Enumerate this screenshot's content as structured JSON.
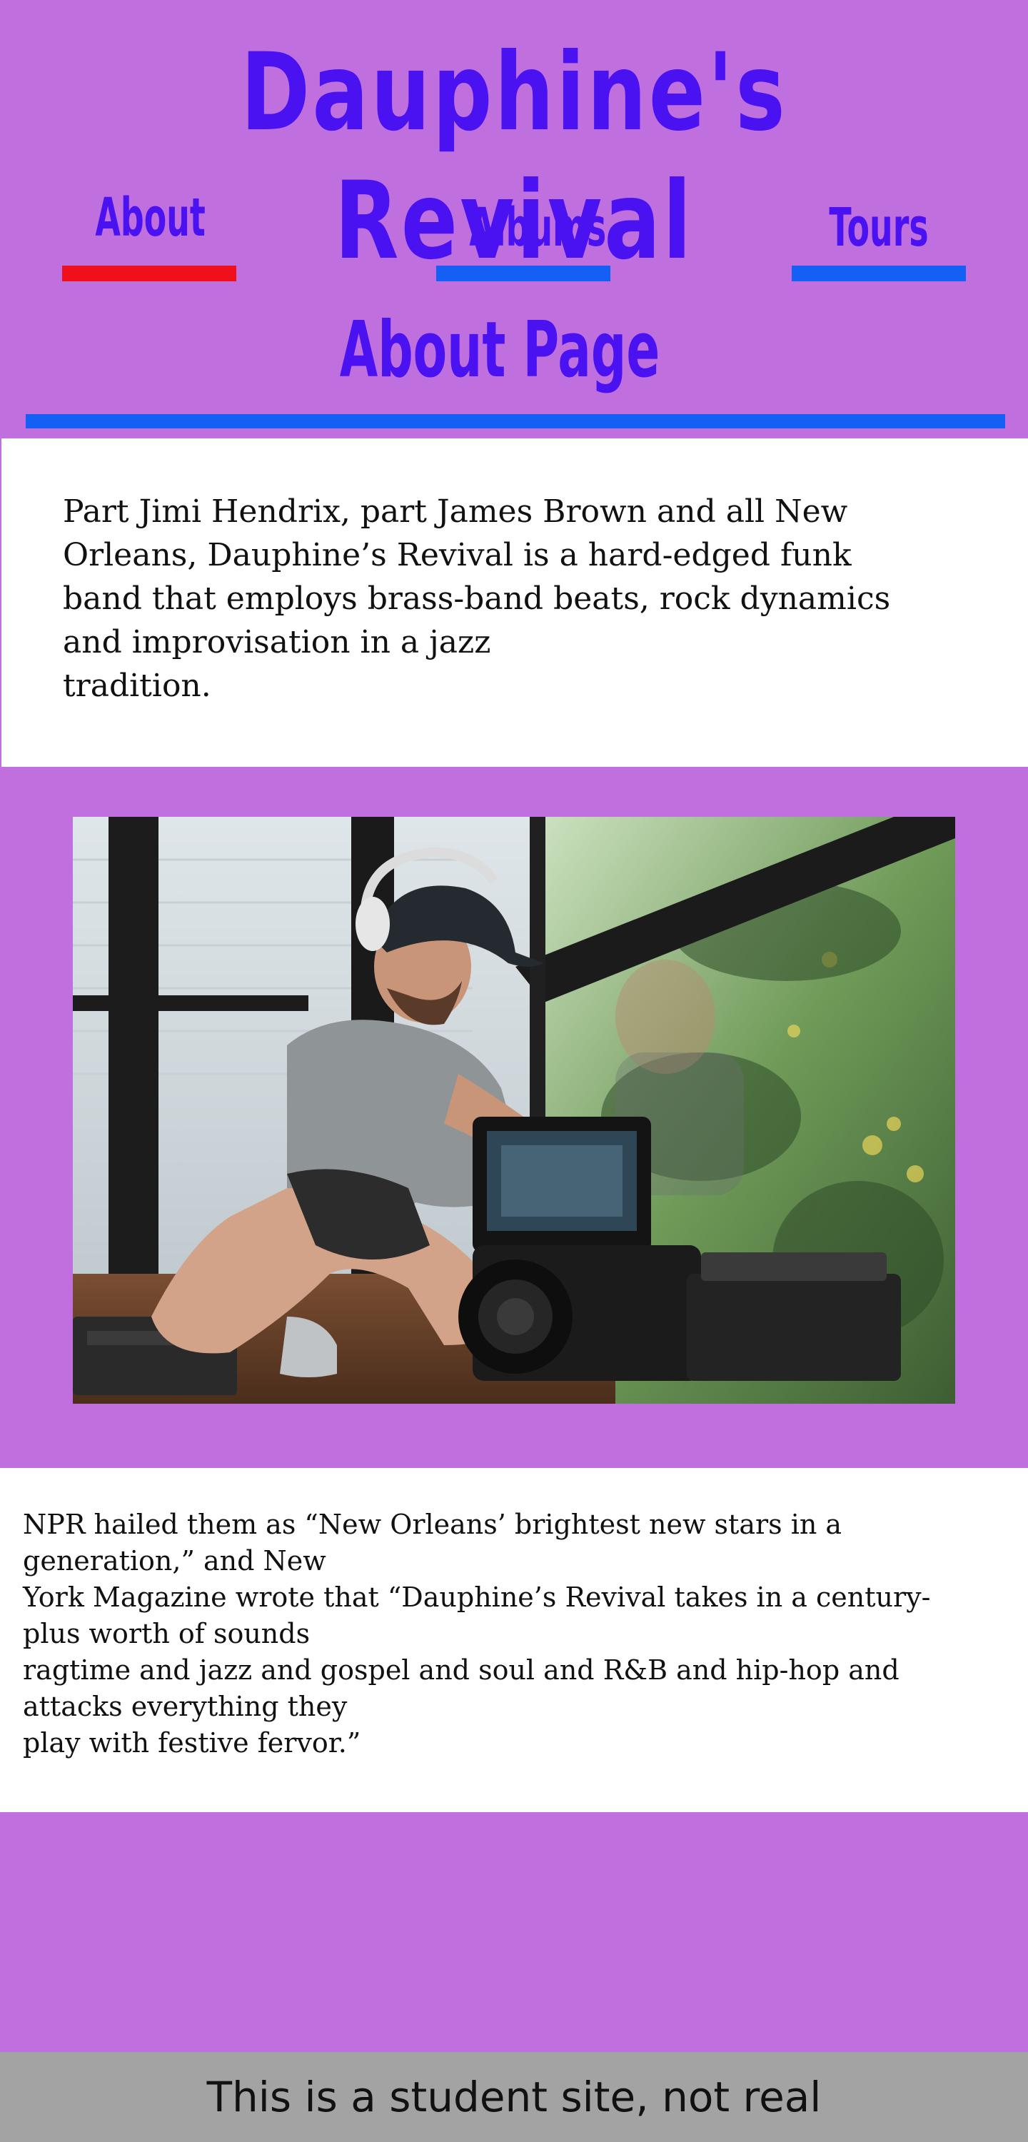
{
  "site": {
    "title": "Dauphine's Revival"
  },
  "nav": {
    "items": [
      {
        "label": "About",
        "active": true
      },
      {
        "label": "Albums",
        "active": false
      },
      {
        "label": "Tours",
        "active": false
      }
    ]
  },
  "page": {
    "heading": "About Page"
  },
  "intro": {
    "lines": [
      "Part Jimi Hendrix, part James Brown and all New",
      "Orleans, Dauphine’s Revival is a hard-edged funk",
      "band that employs brass-band beats, rock dynamics",
      "and improvisation in a jazz",
      "tradition."
    ]
  },
  "photo": {
    "subject": "photographer-with-headphones-and-camera"
  },
  "quote": {
    "lines": [
      "NPR hailed them as “New Orleans’ brightest new stars in a",
      "generation,” and New",
      "York Magazine wrote that “Dauphine’s Revival takes in a century-",
      "plus worth of sounds",
      "ragtime and jazz and gospel and soul and R&B and hip-hop and",
      "attacks everything they",
      "play with festive fervor.”"
    ]
  },
  "footer": {
    "text": "This is a student site, not real"
  },
  "colors": {
    "background": "#c070de",
    "heading": "#4a12f0",
    "nav_underline": "#1460f5",
    "nav_underline_active": "#f0101c",
    "footer": "#a3a3a3"
  }
}
